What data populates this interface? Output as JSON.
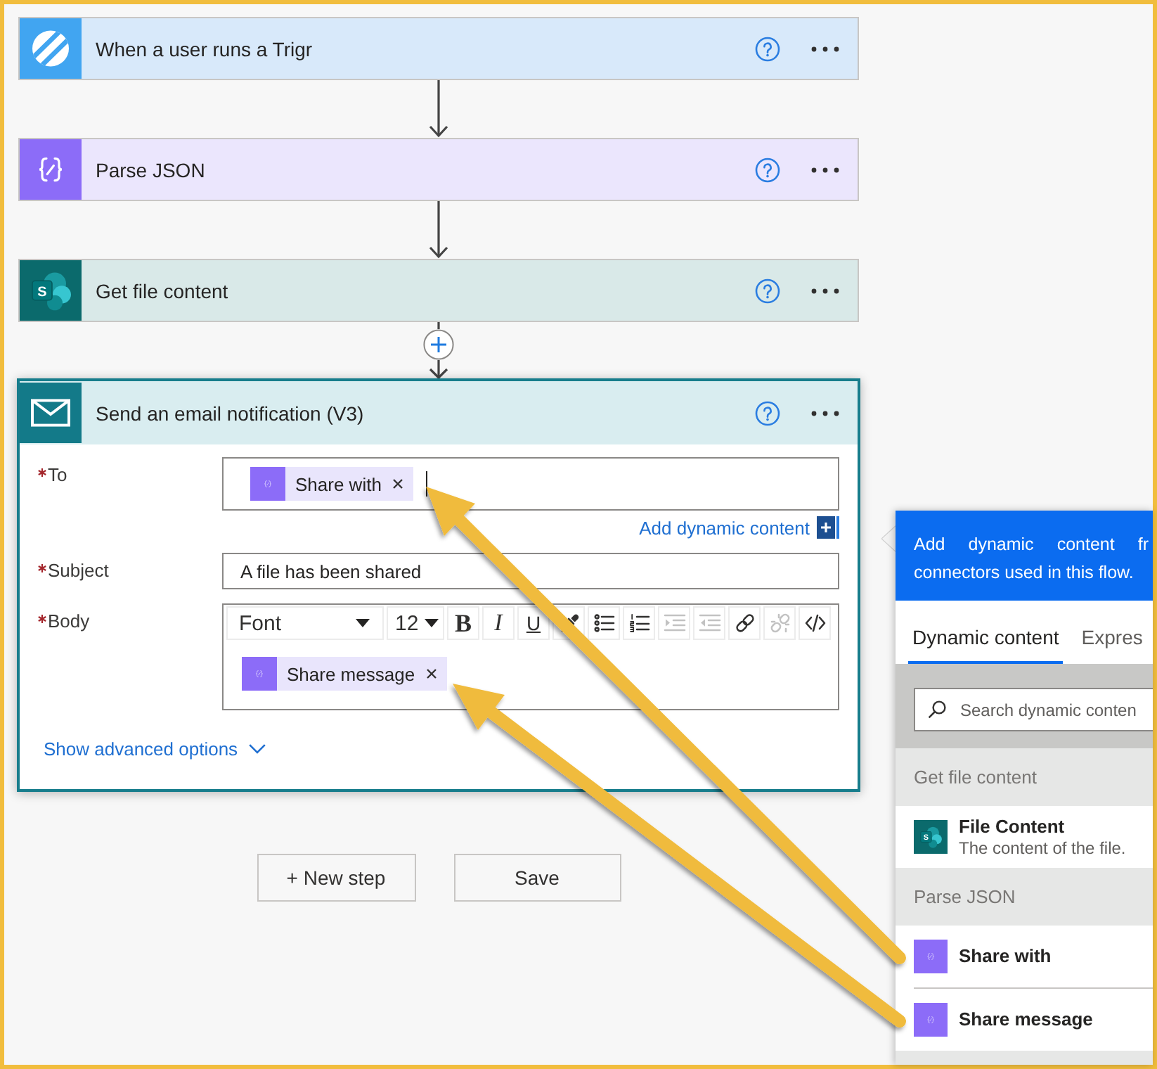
{
  "steps": [
    {
      "kind": "trigger",
      "title": "When a user runs a Trigr",
      "expanded": false
    },
    {
      "kind": "parse",
      "connector": {
        "kind": "arrow"
      },
      "title": "Parse JSON",
      "expanded": false
    },
    {
      "kind": "sharepoint",
      "connector": {
        "kind": "arrow"
      },
      "icon_letter": "S",
      "title": "Get file content",
      "expanded": false
    },
    {
      "kind": "email",
      "connector": {
        "kind": "insert"
      },
      "title": "Send an email notification (V3)",
      "expanded": true,
      "fields": [
        {
          "kind": "tokens",
          "label": "To",
          "required": true,
          "focused": true,
          "tokens": [
            "Share with"
          ],
          "link": "Add dynamic content"
        },
        {
          "kind": "text",
          "label": "Subject",
          "required": true,
          "focused": false,
          "value": "A file has been shared"
        },
        {
          "kind": "editor",
          "label": "Body",
          "required": true,
          "focused": false,
          "toolbar": [
            {
              "kind": "font",
              "label": "Font",
              "disabled": false
            },
            {
              "kind": "size",
              "label": "12",
              "disabled": false
            },
            {
              "kind": "bold",
              "label": "B",
              "disabled": false
            },
            {
              "kind": "italic",
              "label": "I",
              "disabled": false
            },
            {
              "kind": "underline",
              "label": "U",
              "disabled": false
            },
            {
              "kind": "color",
              "disabled": false
            },
            {
              "kind": "bullets",
              "disabled": false
            },
            {
              "kind": "numbering",
              "disabled": false
            },
            {
              "kind": "indent",
              "disabled": true
            },
            {
              "kind": "outdent",
              "disabled": true
            },
            {
              "kind": "link",
              "disabled": false
            },
            {
              "kind": "unlink",
              "disabled": true
            },
            {
              "kind": "code",
              "disabled": false
            }
          ],
          "tokens": [
            "Share message"
          ]
        }
      ],
      "advanced_link": "Show advanced options"
    }
  ],
  "buttons": [
    "+ New step",
    "Save"
  ],
  "dynamic_panel": {
    "intro_lines": [
      "Add dynamic content fr",
      "connectors used in this flow."
    ],
    "tabs": [
      {
        "label": "Dynamic content",
        "selected": true
      },
      {
        "label": "Expres",
        "selected": false
      }
    ],
    "search": {
      "placeholder": "Search dynamic conten"
    },
    "sections": [
      {
        "title": "Get file content",
        "items": [
          {
            "kind": "sharepoint",
            "icon_letter": "S",
            "title": "File Content",
            "description": "The content of the file."
          }
        ]
      },
      {
        "title": "Parse JSON",
        "items": [
          {
            "kind": "token",
            "title": "Share with"
          },
          {
            "kind": "token",
            "title": "Share message"
          }
        ]
      }
    ]
  }
}
